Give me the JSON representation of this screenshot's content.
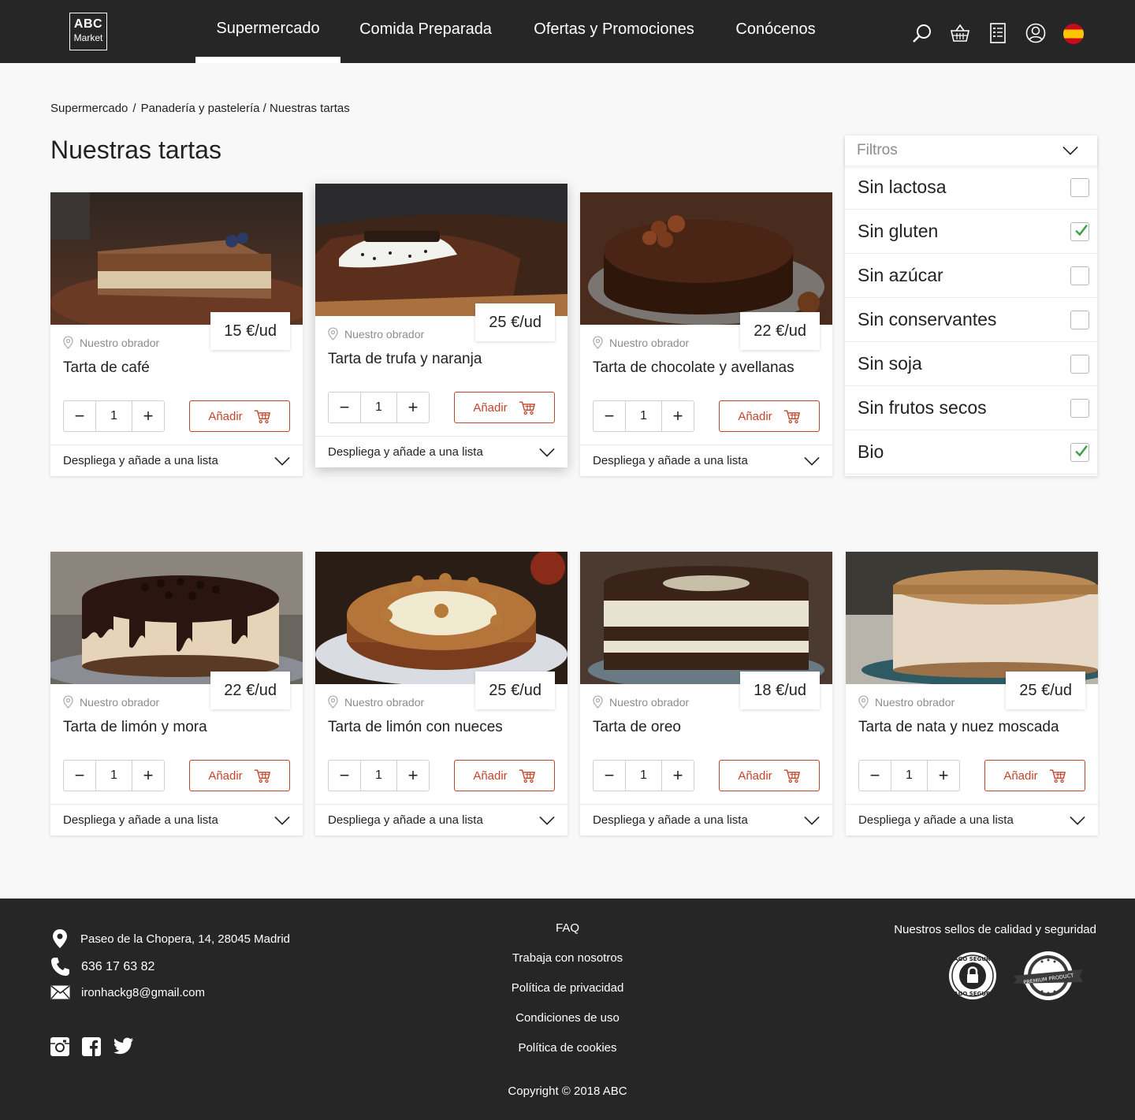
{
  "header": {
    "logo": {
      "line1": "ABC",
      "line2": "Market"
    },
    "nav": [
      "Supermercado",
      "Comida Preparada",
      "Ofertas y Promociones",
      "Conócenos"
    ],
    "active_nav": "Supermercado",
    "icons": [
      "search-icon",
      "basket-icon",
      "shopping-list-icon",
      "user-icon",
      "spain-flag-icon"
    ]
  },
  "breadcrumb": {
    "level1": "Supermercado",
    "sep": "/",
    "level2": "Panadería y pastelería / Nuestras tartas"
  },
  "page_title": "Nuestras tartas",
  "common": {
    "origin": "Nuestro obrador",
    "add_label": "Añadir",
    "list_label": "Despliega y añade a una lista"
  },
  "products": [
    {
      "name": "Tarta de café",
      "price": "15 €/ud",
      "qty": "1"
    },
    {
      "name": "Tarta de trufa y naranja",
      "price": "25 €/ud",
      "qty": "1"
    },
    {
      "name": "Tarta de chocolate y avellanas",
      "price": "22 €/ud",
      "qty": "1"
    },
    {
      "name": "Tarta de limón y mora",
      "price": "22 €/ud",
      "qty": "1"
    },
    {
      "name": "Tarta de limón con nueces",
      "price": "25 €/ud",
      "qty": "1"
    },
    {
      "name": "Tarta de oreo",
      "price": "18 €/ud",
      "qty": "1"
    },
    {
      "name": "Tarta de nata y nuez moscada",
      "price": "25 €/ud",
      "qty": "1"
    }
  ],
  "filters": {
    "title": "Filtros",
    "options": [
      {
        "label": "Sin lactosa",
        "checked": false
      },
      {
        "label": "Sin gluten",
        "checked": true
      },
      {
        "label": "Sin azúcar",
        "checked": false
      },
      {
        "label": "Sin conservantes",
        "checked": false
      },
      {
        "label": "Sin soja",
        "checked": false
      },
      {
        "label": "Sin frutos secos",
        "checked": false
      },
      {
        "label": "Bio",
        "checked": true
      }
    ]
  },
  "footer": {
    "address": "Paseo de la Chopera, 14, 28045 Madrid",
    "phone": "636 17 63 82",
    "email": "ironhackg8@gmail.com",
    "links": [
      "FAQ",
      "Trabaja con nosotros",
      "Política de privacidad",
      "Condiciones de uso",
      "Política de cookies"
    ],
    "copyright": "Copyright © 2018 ABC",
    "seals_title": "Nuestros sellos de calidad y seguridad",
    "seals": [
      "PAGO SEGURO",
      "PREMIUM PRODUCT"
    ],
    "social": [
      "instagram-icon",
      "facebook-icon",
      "twitter-icon"
    ]
  },
  "colors": {
    "header_bg": "#262626",
    "accent": "#c2452d",
    "check": "#3aa142",
    "page_bg": "#f8f8f8"
  }
}
